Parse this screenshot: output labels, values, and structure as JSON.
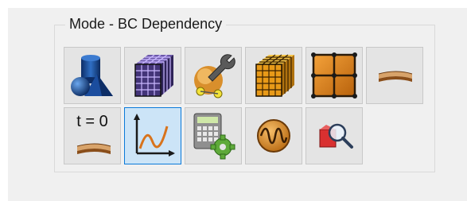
{
  "group": {
    "title": "Mode - BC Dependency"
  },
  "buttons": [
    {
      "icon": "geometry-part-icon"
    },
    {
      "icon": "mesh-cube-icon"
    },
    {
      "icon": "tools-wrench-icon"
    },
    {
      "icon": "gold-mesh-cube-icon"
    },
    {
      "icon": "grid-nodes-icon"
    },
    {
      "icon": "shell-strip-icon"
    },
    {
      "icon": "initial-condition-icon",
      "label": "t = 0"
    },
    {
      "icon": "function-curve-icon",
      "active": true
    },
    {
      "icon": "calculator-gear-icon"
    },
    {
      "icon": "wave-signal-icon"
    },
    {
      "icon": "query-magnifier-icon"
    }
  ],
  "colors": {
    "active_border": "#0a7ad9",
    "active_fill": "#cce4f7",
    "button_fill": "#e4e4e4",
    "panel": "#f0f0f0"
  }
}
